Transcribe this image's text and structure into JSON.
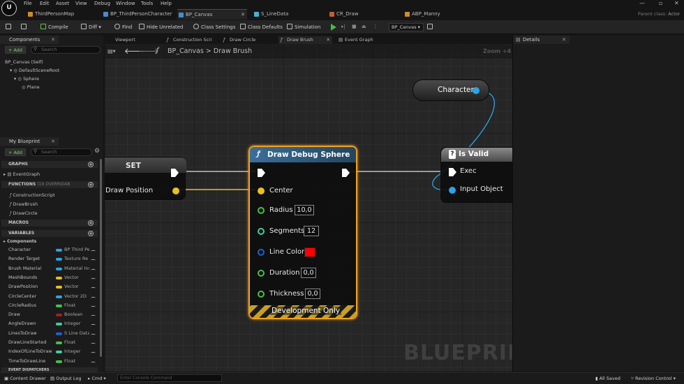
{
  "app": {
    "logo": "U",
    "menu": [
      "File",
      "Edit",
      "Asset",
      "View",
      "Debug",
      "Window",
      "Tools",
      "Help"
    ],
    "parent_class_label": "Parent class:",
    "parent_class_value": "Actor"
  },
  "tabs": [
    {
      "label": "ThirdPersonMap",
      "color": "#d08a2a"
    },
    {
      "label": "BP_ThirdPersonCharacter",
      "color": "#4a8ad0"
    },
    {
      "label": "BP_Canvas",
      "color": "#4a8ad0"
    },
    {
      "label": "S_LineData",
      "color": "#4ab0d0"
    },
    {
      "label": "CR_Draw",
      "color": "#c06030"
    },
    {
      "label": "ABP_Manny",
      "color": "#d08a2a"
    }
  ],
  "toolbar": {
    "compile": "Compile",
    "diff": "Diff",
    "find": "Find",
    "hide_unrelated": "Hide Unrelated",
    "class_settings": "Class Settings",
    "class_defaults": "Class Defaults",
    "simulation": "Simulation",
    "debug_object": "BP_Canvas"
  },
  "components": {
    "title": "Components",
    "add": "+ Add",
    "search": "Search",
    "tree": [
      "BP_Canvas (Self)",
      "DefaultSceneRoot",
      "Sphere",
      "Plane"
    ]
  },
  "my_blueprint": {
    "title": "My Blueprint",
    "add": "+ Add",
    "search": "Search",
    "graphs_header": "GRAPHS",
    "graphs": [
      "EventGraph"
    ],
    "functions_header": "FUNCTIONS",
    "functions_count": "(19 OVERRIDAB",
    "functions": [
      "ConstructionScript",
      "DrawBrush",
      "DrawCircle"
    ],
    "macros_header": "MACROS",
    "variables_header": "VARIABLES",
    "components_cat": "Components",
    "variables": [
      {
        "name": "Character",
        "type": "BP Third Pe",
        "color": "#2aa4e8"
      },
      {
        "name": "Render Target",
        "type": "Texture Re",
        "color": "#2aa4e8"
      },
      {
        "name": "Brush Material",
        "type": "Material Ins",
        "color": "#2aa4e8"
      },
      {
        "name": "MeshBounds",
        "type": "Vector",
        "color": "#e8c020"
      },
      {
        "name": "DrawPosition",
        "type": "Vector",
        "color": "#e8c020"
      },
      {
        "name": "CircleCenter",
        "type": "Vector 2D",
        "color": "#2aa4e8"
      },
      {
        "name": "CircleRadius",
        "type": "Float",
        "color": "#48c048"
      },
      {
        "name": "Draw",
        "type": "Boolean",
        "color": "#a02020"
      },
      {
        "name": "AngleDrawn",
        "type": "Integer",
        "color": "#3ad0a0"
      },
      {
        "name": "LinesToDraw",
        "type": "S Line Data",
        "color": "#2060d0"
      },
      {
        "name": "DrawLineStarted",
        "type": "Float",
        "color": "#48c048"
      },
      {
        "name": "IndexOfLineToDraw",
        "type": "Integer",
        "color": "#3ad0a0"
      },
      {
        "name": "TimeToDrawLine",
        "type": "Float",
        "color": "#48c048"
      }
    ],
    "event_dispatchers_header": "EVENT DISPATCHERS"
  },
  "graph_tabs": [
    "Viewport",
    "Construction Scri",
    "Draw Circle",
    "Draw Brush",
    "Event Graph"
  ],
  "breadcrumb": {
    "blueprint": "BP_Canvas",
    "separator": ">",
    "graph": "Draw Brush",
    "zoom": "Zoom +4"
  },
  "watermark": "BLUEPRINT",
  "nodes": {
    "set": {
      "title": "SET",
      "pin": "Draw Position"
    },
    "draw_debug_sphere": {
      "title": "Draw Debug Sphere",
      "pins": [
        {
          "label": "Center",
          "color": "#e8c020"
        },
        {
          "label": "Radius",
          "value": "10,0",
          "color": "#48c048"
        },
        {
          "label": "Segments",
          "value": "12",
          "color": "#3ad0a0"
        },
        {
          "label": "Line Color",
          "value_color": "#ff0000",
          "color": "#2060d0"
        },
        {
          "label": "Duration",
          "value": "0,0",
          "color": "#48c048"
        },
        {
          "label": "Thickness",
          "value": "0,0",
          "color": "#48c048"
        }
      ],
      "footer": "Development Only"
    },
    "character": {
      "title": "Character"
    },
    "is_valid": {
      "title": "Is Valid",
      "exec": "Exec",
      "input": "Input Object"
    }
  },
  "details": {
    "title": "Details"
  },
  "statusbar": {
    "content_drawer": "Content Drawer",
    "output_log": "Output Log",
    "cmd": "Cmd",
    "console_placeholder": "Enter Console Command",
    "all_saved": "All Saved",
    "revision_control": "Revision Control"
  }
}
